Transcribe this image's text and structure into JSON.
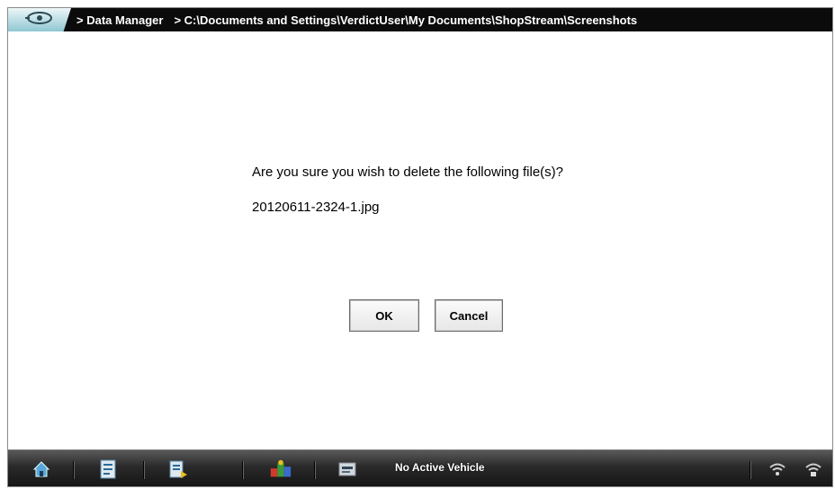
{
  "header": {
    "logo_icon": "snap-on-logo-icon",
    "breadcrumb_1": "> Data Manager",
    "breadcrumb_2": "> C:\\Documents and Settings\\VerdictUser\\My Documents\\ShopStream\\Screenshots"
  },
  "dialog": {
    "message": "Are you sure you wish to delete the following file(s)?",
    "file_name": "20120611-2324-1.jpg",
    "ok_label": "OK",
    "cancel_label": "Cancel"
  },
  "taskbar": {
    "status_text": "No Active Vehicle",
    "icons": [
      "home-icon",
      "vehicle-id-icon",
      "scanner-icon",
      "guided-component-test-icon",
      "shop-stream-icon",
      "wifi-icon",
      "connection-icon"
    ]
  },
  "colors": {
    "titlebar_bg": "#0b0b0b",
    "logo_tab": "#8fc7d2",
    "taskbar_bg": "#2a2a2a"
  }
}
